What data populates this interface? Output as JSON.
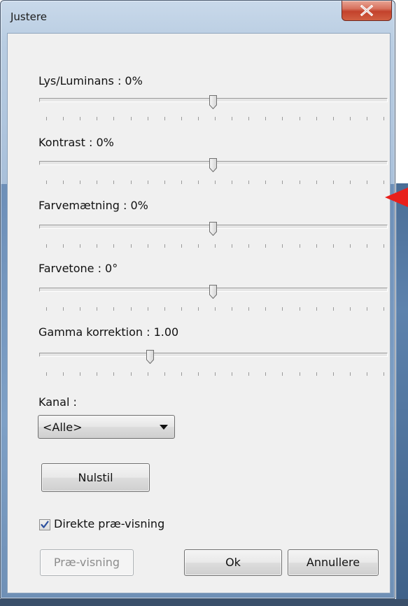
{
  "window": {
    "title": "Justere",
    "close_label": "X"
  },
  "sliders": [
    {
      "label": "Lys/Luminans : 0%",
      "value": 0.5
    },
    {
      "label": "Kontrast : 0%",
      "value": 0.5
    },
    {
      "label": "Farvemætning : 0%",
      "value": 0.5
    },
    {
      "label": "Farvetone : 0°",
      "value": 0.5
    },
    {
      "label": "Gamma korrektion : 1.00",
      "value": 0.31
    }
  ],
  "channel": {
    "label": "Kanal :",
    "selected": "<Alle>"
  },
  "buttons": {
    "reset": "Nulstil",
    "preview": "Præ-visning",
    "ok": "Ok",
    "cancel": "Annullere"
  },
  "live_preview": {
    "label": "Direkte præ-visning",
    "checked": true
  },
  "colors": {
    "close_button": "#c3422c",
    "annotation_arrow": "#e8201c"
  },
  "icons": [
    "close-icon",
    "chevron-down-icon",
    "checkmark-icon",
    "slider-thumb-icon",
    "pointer-arrow-icon"
  ]
}
